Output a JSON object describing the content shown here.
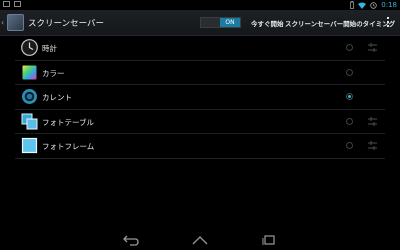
{
  "status_bar": {
    "time": "0:18",
    "left_icons": [
      "image-icon",
      "mail-icon"
    ],
    "right_icons": [
      "battery-icon",
      "wifi-icon",
      "alarm-icon"
    ]
  },
  "action_bar": {
    "title": "スクリーンセーバー",
    "switch_label": "ON",
    "start_now": "今すぐ開始",
    "timing": "スクリーンセーバー開始のタイミング"
  },
  "items": [
    {
      "label": "時計",
      "icon": "clock-icon",
      "selected": false,
      "has_settings": true
    },
    {
      "label": "カラー",
      "icon": "colors-icon",
      "selected": false,
      "has_settings": false
    },
    {
      "label": "カレント",
      "icon": "currents-icon",
      "selected": true,
      "has_settings": false
    },
    {
      "label": "フォトテーブル",
      "icon": "photo-table-icon",
      "selected": false,
      "has_settings": true
    },
    {
      "label": "フォトフレーム",
      "icon": "photo-frame-icon",
      "selected": false,
      "has_settings": true
    }
  ],
  "colors": {
    "accent": "#33b5e5",
    "switch_on": "#1a7ca3",
    "background": "#000000"
  }
}
